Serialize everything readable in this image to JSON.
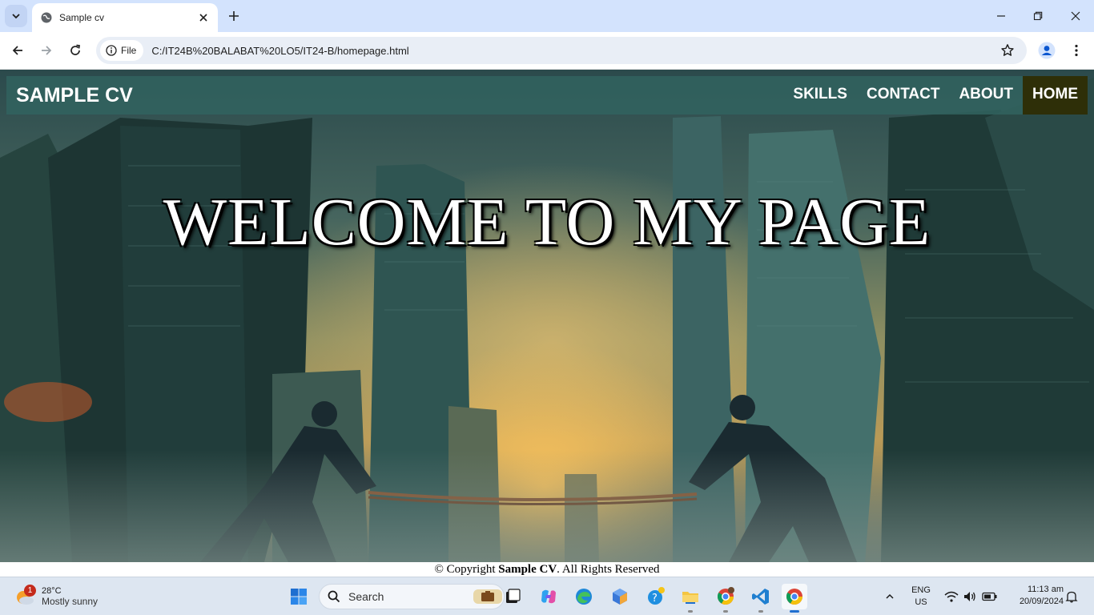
{
  "browser": {
    "tab_title": "Sample cv",
    "file_label": "File",
    "url": "C:/IT24B%20BALABAT%20LO5/IT24-B/homepage.html"
  },
  "page": {
    "brand": "SAMPLE CV",
    "nav": [
      {
        "label": "SKILLS",
        "active": false
      },
      {
        "label": "CONTACT",
        "active": false
      },
      {
        "label": "ABOUT",
        "active": false
      },
      {
        "label": "HOME",
        "active": true
      }
    ],
    "hero_title": "WELCOME TO MY PAGE",
    "footer": {
      "prefix": "© Copyright ",
      "name": "Sample CV",
      "suffix": ". All Rights Reserved"
    }
  },
  "taskbar": {
    "weather": {
      "badge": "1",
      "temp": "28°C",
      "desc": "Mostly sunny"
    },
    "search_label": "Search",
    "lang_top": "ENG",
    "lang_bottom": "US",
    "time": "11:13 am",
    "date": "20/09/2024"
  },
  "colors": {
    "navbar": "#31625f",
    "active_nav": "#2e2f08",
    "tabbar": "#d3e3fd"
  }
}
